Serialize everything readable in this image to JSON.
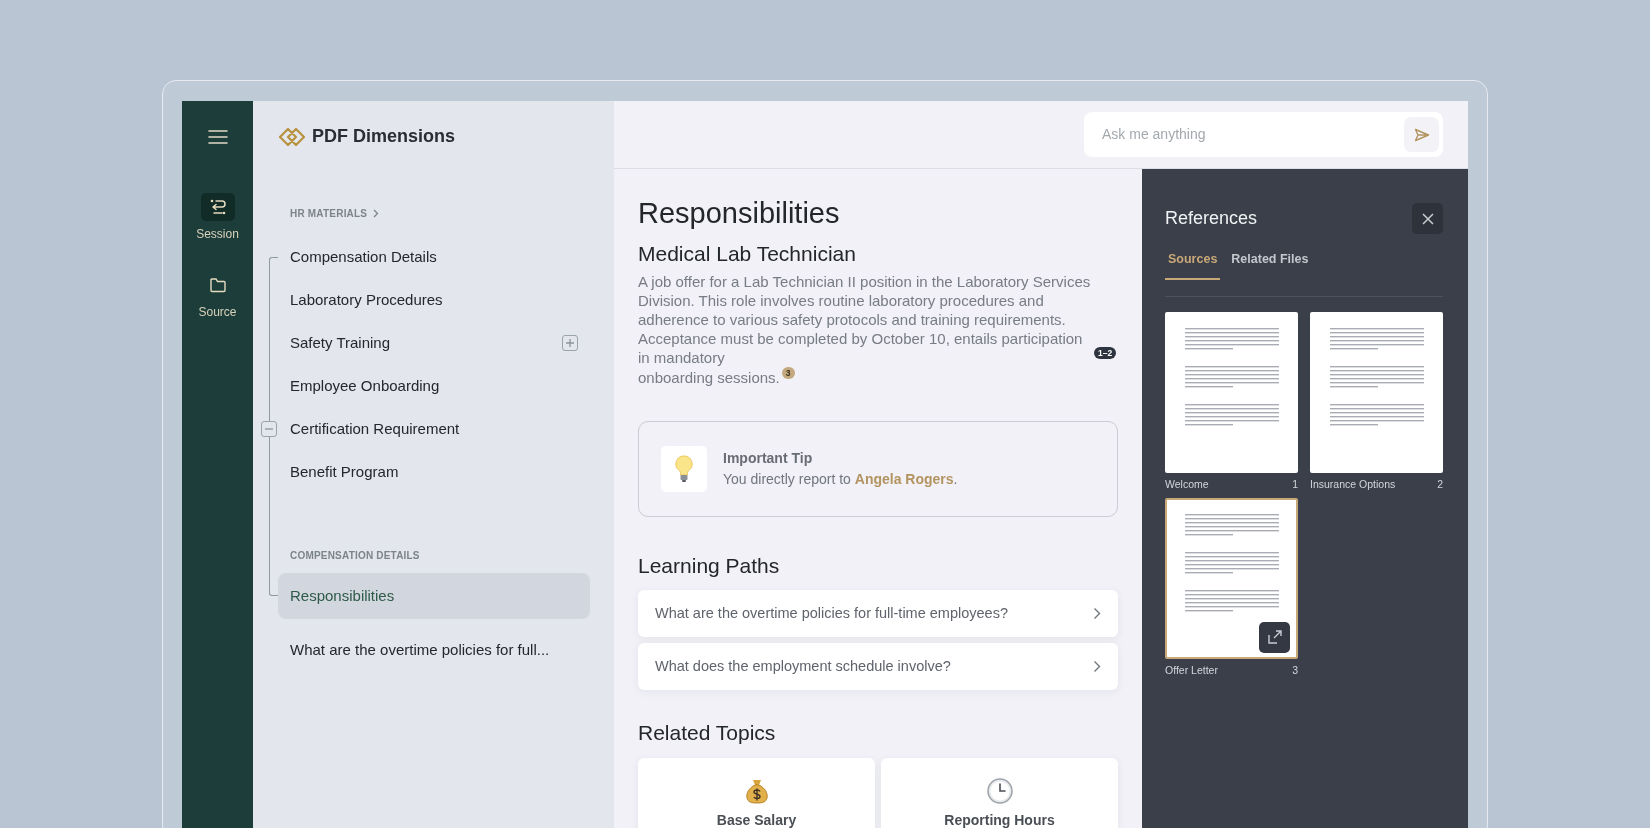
{
  "rail": {
    "items": [
      {
        "label": "Session",
        "selected": true
      },
      {
        "label": "Source",
        "selected": false
      }
    ]
  },
  "brand": {
    "name": "PDF Dimensions"
  },
  "sidebar": {
    "sections": [
      {
        "heading": "HR MATERIALS",
        "items": [
          {
            "label": "Compensation Details",
            "selected": false
          },
          {
            "label": "Laboratory Procedures",
            "selected": false
          },
          {
            "label": "Safety Training",
            "selected": false,
            "expanded": false
          },
          {
            "label": "Employee Onboarding",
            "selected": false
          },
          {
            "label": "Certification Requirement",
            "selected": false,
            "expanded": true
          },
          {
            "label": "Benefit Program",
            "selected": false
          }
        ]
      },
      {
        "heading": "COMPENSATION DETAILS",
        "items": [
          {
            "label": "Responsibilities",
            "selected": true
          },
          {
            "label": "What are the overtime policies for full...",
            "selected": false
          }
        ]
      }
    ]
  },
  "search": {
    "placeholder": "Ask me anything"
  },
  "article": {
    "title": "Responsibilities",
    "subtitle": "Medical Lab Technician",
    "description": [
      {
        "text": "A job offer for a Lab Technician II position in the Laboratory Services Division. This role involves routine laboratory procedures and adherence to various safety protocols and training requirements. Acceptance must be completed by October 10, entails participation in mandatory",
        "citation": "1–2",
        "citation_selected": false
      },
      {
        "text": "onboarding sessions.",
        "citation": "3",
        "citation_selected": true
      }
    ],
    "tip": {
      "title": "Important Tip",
      "text": "You directly report to",
      "link": "Angela Rogers",
      "text_after": "."
    },
    "learning_paths": {
      "heading": "Learning Paths",
      "items": [
        "What are the overtime policies for full-time employees?",
        "What does the employment schedule involve?"
      ]
    },
    "related_topics": {
      "heading": "Related Topics",
      "items": [
        {
          "label": "Base Salary"
        },
        {
          "label": "Reporting Hours"
        }
      ]
    }
  },
  "references": {
    "title": "References",
    "tabs": [
      {
        "label": "Sources",
        "selected": true
      },
      {
        "label": "Related Files",
        "selected": false
      }
    ],
    "sources": [
      {
        "name": "Welcome",
        "page": "1",
        "selected": false
      },
      {
        "name": "Insurance Options",
        "page": "2",
        "selected": false
      },
      {
        "name": "Offer Letter",
        "page": "3",
        "selected": true
      }
    ]
  }
}
